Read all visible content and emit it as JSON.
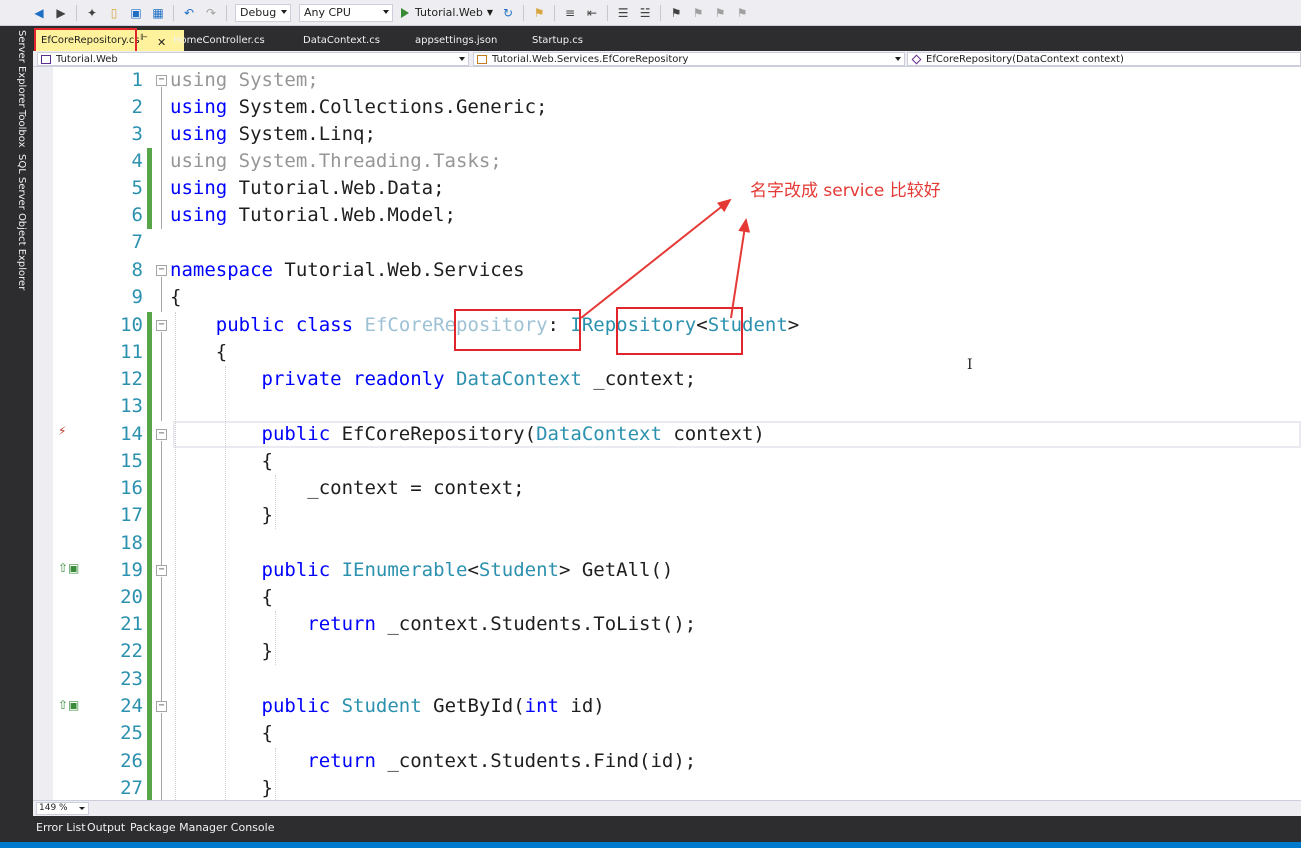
{
  "toolbar": {
    "config_combo": "Debug",
    "platform_combo": "Any CPU",
    "run_label": "Tutorial.Web"
  },
  "left_strip": {
    "server_explorer": "Server Explorer",
    "toolbox": "Toolbox",
    "sql_explorer": "SQL Server Object Explorer"
  },
  "doc_tabs": [
    {
      "label": "EfCoreRepository.cs",
      "active": true
    },
    {
      "label": "HomeController.cs"
    },
    {
      "label": "DataContext.cs"
    },
    {
      "label": "appsettings.json"
    },
    {
      "label": "Startup.cs"
    }
  ],
  "nav_bar": {
    "project": "Tutorial.Web",
    "type": "Tutorial.Web.Services.EfCoreRepository",
    "member": "EfCoreRepository(DataContext context)"
  },
  "code": {
    "line_numbers": [
      "1",
      "2",
      "3",
      "4",
      "5",
      "6",
      "7",
      "8",
      "9",
      "10",
      "11",
      "12",
      "13",
      "14",
      "15",
      "16",
      "17",
      "18",
      "19",
      "20",
      "21",
      "22",
      "23",
      "24",
      "25",
      "26",
      "27"
    ]
  },
  "annotation": {
    "text": "名字改成 service 比较好",
    "color": "#e53935"
  },
  "editor_footer": {
    "zoom": "149 %"
  },
  "bottom_tabs": [
    "Error List",
    "Output",
    "Package Manager Console"
  ],
  "colors": {
    "keyword": "#0000ff",
    "type": "#2b91af",
    "highlight": "#e0262c",
    "active_tab": "#fff29d",
    "change_bar": "#57a64a",
    "chrome_dark": "#2d2d30"
  }
}
